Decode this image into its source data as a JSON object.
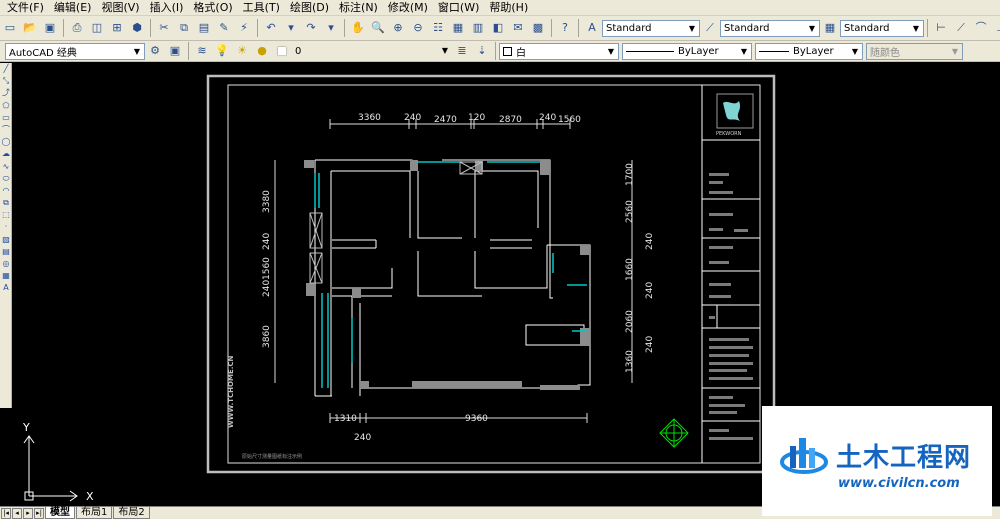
{
  "menu": [
    "文件(F)",
    "编辑(E)",
    "视图(V)",
    "插入(I)",
    "格式(O)",
    "工具(T)",
    "绘图(D)",
    "标注(N)",
    "修改(M)",
    "窗口(W)",
    "帮助(H)"
  ],
  "toolbar1": {
    "text_style": "Standard",
    "dim_style": "Standard",
    "table_style": "Standard"
  },
  "toolbar2": {
    "workspace": "AutoCAD 经典",
    "layer": "0",
    "color": "白",
    "linetype": "ByLayer",
    "lineweight": "ByLayer",
    "plot_style": "随颜色"
  },
  "tabs": [
    "模型",
    "布局1",
    "布局2"
  ],
  "drawing": {
    "dims_top": [
      "3360",
      "240",
      "2470",
      "120",
      "2870",
      "240",
      "1560"
    ],
    "dims_left": [
      "3380",
      "240",
      "1560",
      "240",
      "3860"
    ],
    "dims_right": [
      "1700",
      "2560",
      "240",
      "1660",
      "240",
      "2060",
      "240",
      "1360"
    ],
    "dims_bottom": [
      "1310",
      "9360"
    ],
    "dim_bottom_sub": "240",
    "side_watermark": "WWW.TCHOME.CN",
    "title_logo_text": "PEKWORN",
    "footer_note": "原始尺寸测量图纸标注示例",
    "ucs_x": "X",
    "ucs_y": "Y"
  },
  "watermark": {
    "name": "土木工程网",
    "url": "www.civilcn.com"
  },
  "colors": {
    "ui_bg": "#ece9d8",
    "canvas": "#000000",
    "line": "#ffffff",
    "window_cyan": "#00c8c8",
    "wall_gray": "#808080",
    "brand_blue": "#1565c0"
  }
}
